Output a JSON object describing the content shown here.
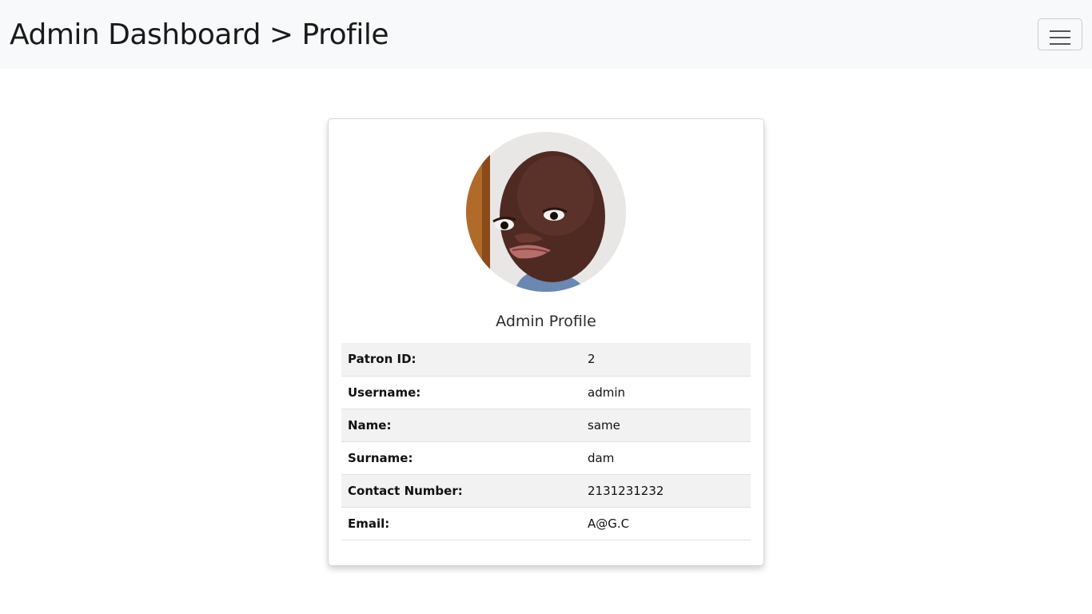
{
  "header": {
    "title": "Admin Dashboard > Profile",
    "menu_icon": "hamburger-menu-icon"
  },
  "profile": {
    "title": "Admin Profile",
    "avatar": "profile-photo",
    "rows": [
      {
        "label": "Patron ID:",
        "value": "2"
      },
      {
        "label": "Username:",
        "value": "admin"
      },
      {
        "label": "Name:",
        "value": "same"
      },
      {
        "label": "Surname:",
        "value": "dam"
      },
      {
        "label": "Contact Number:",
        "value": "2131231232"
      },
      {
        "label": "Email:",
        "value": "A@G.C"
      }
    ]
  },
  "colors": {
    "navbar_bg": "#f8f9fa",
    "stripe_bg": "#f2f2f2",
    "border": "#dee2e6"
  }
}
